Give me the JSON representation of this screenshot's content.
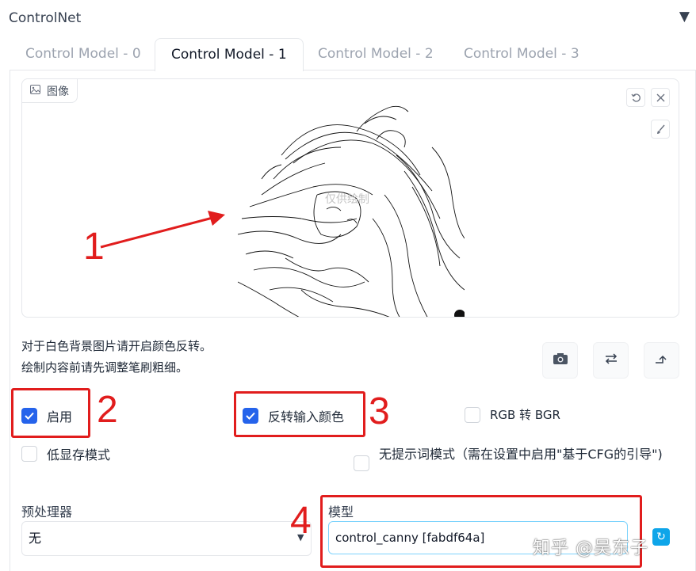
{
  "accordion": {
    "title": "ControlNet",
    "toggle_icon": "▼"
  },
  "tabs": [
    {
      "label": "Control Model - 0",
      "active": false
    },
    {
      "label": "Control Model - 1",
      "active": true
    },
    {
      "label": "Control Model - 2",
      "active": false
    },
    {
      "label": "Control Model - 3",
      "active": false
    }
  ],
  "image_input": {
    "label": "图像",
    "label_icon": "image-icon",
    "tools": [
      "undo-icon",
      "close-icon",
      "brush-icon"
    ],
    "canvas_watermark": "仅供绘制"
  },
  "hints": {
    "line1": "对于白色背景图片请开启颜色反转。",
    "line2": "绘制内容前请先调整笔刷粗细。"
  },
  "action_buttons": [
    "camera-icon",
    "swap-icon",
    "send-dimensions-icon"
  ],
  "checkboxes": {
    "enable": {
      "label": "启用",
      "checked": true
    },
    "invert": {
      "label": "反转输入颜色",
      "checked": true
    },
    "rgb_bgr": {
      "label": "RGB 转 BGR",
      "checked": false
    },
    "low_vram": {
      "label": "低显存模式",
      "checked": false
    },
    "guess_mode": {
      "label": "无提示词模式（需在设置中启用\"基于CFG的引导\")",
      "checked": false
    }
  },
  "preprocessor": {
    "label": "预处理器",
    "value": "无"
  },
  "model": {
    "label": "模型",
    "value": "control_canny [fabdf64a]"
  },
  "annotations": {
    "n1": "1",
    "n2": "2",
    "n3": "3",
    "n4": "4",
    "color": "#e11d1d"
  },
  "watermark": "知乎 @吴东子",
  "colors": {
    "accent": "#2563eb",
    "highlight": "#e11d1d",
    "refresh": "#0ea5e9"
  }
}
